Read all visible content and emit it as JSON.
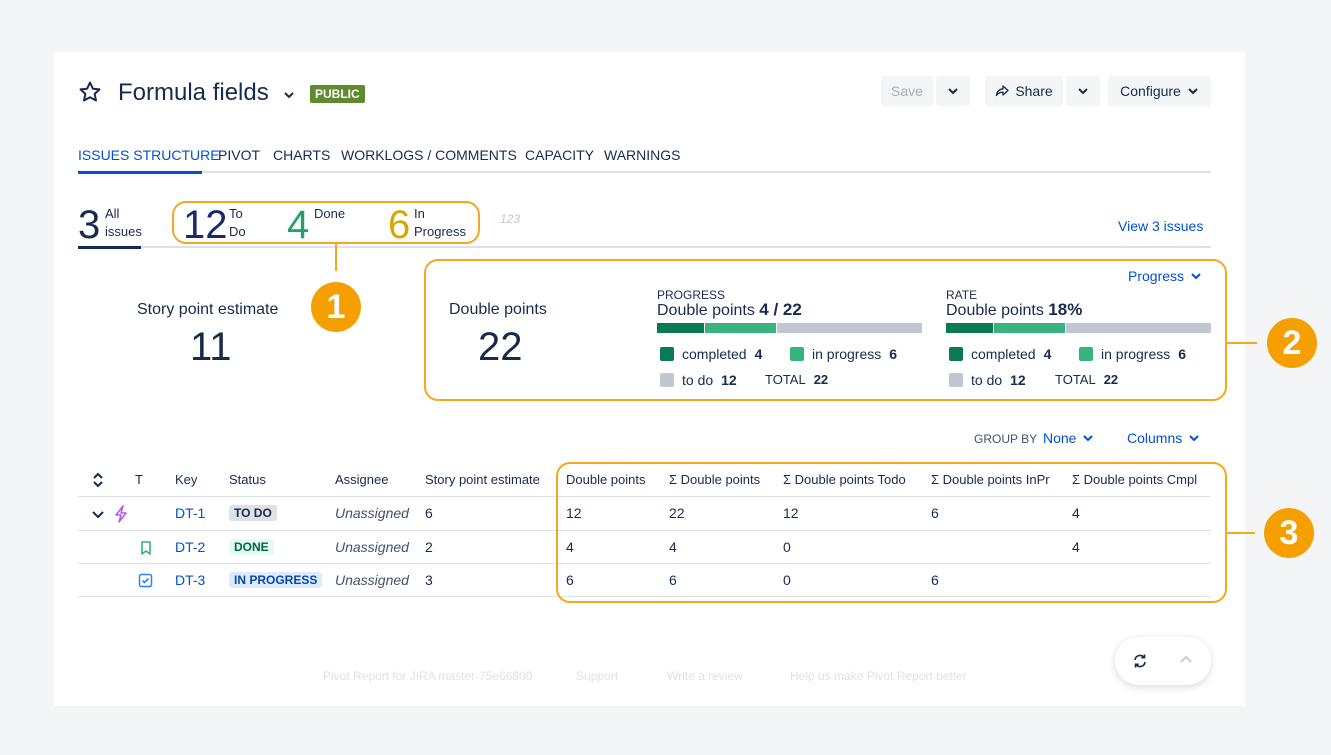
{
  "header": {
    "title": "Formula fields",
    "badge": "PUBLIC",
    "save_label": "Save",
    "share_label": "Share",
    "configure_label": "Configure"
  },
  "tabs": [
    {
      "label": "ISSUES STRUCTURE",
      "active": true
    },
    {
      "label": "PIVOT"
    },
    {
      "label": "CHARTS"
    },
    {
      "label": "WORKLOGS / COMMENTS"
    },
    {
      "label": "CAPACITY"
    },
    {
      "label": "WARNINGS"
    }
  ],
  "summary": {
    "all": {
      "value": "3",
      "label1": "All",
      "label2": "issues"
    },
    "todo": {
      "value": "12",
      "label1": "To",
      "label2": "Do",
      "color": "#172b70"
    },
    "done": {
      "value": "4",
      "label1": "Done",
      "color": "#22a06b"
    },
    "inprogress": {
      "value": "6",
      "label1": "In",
      "label2": "Progress",
      "color": "#d4a800"
    },
    "numbers_icon": "123",
    "view_link": "View 3 issues"
  },
  "stats": {
    "story": {
      "title": "Story point estimate",
      "value": "11"
    },
    "double": {
      "title": "Double points",
      "value": "22"
    },
    "progress_menu": "Progress",
    "progress": {
      "caption": "PROGRESS",
      "title": "Double points",
      "value": "4 / 22",
      "completed_fraction": 0.18,
      "inprogress_fraction": 0.27,
      "completed_label": "completed",
      "completed_value": "4",
      "inprogress_label": "in progress",
      "inprogress_value": "6",
      "todo_label": "to do",
      "todo_value": "12",
      "total_label": "TOTAL",
      "total_value": "22"
    },
    "rate": {
      "caption": "RATE",
      "title": "Double points",
      "value": "18%",
      "completed_fraction": 0.18,
      "inprogress_fraction": 0.27,
      "completed_label": "completed",
      "completed_value": "4",
      "inprogress_label": "in progress",
      "inprogress_value": "6",
      "todo_label": "to do",
      "todo_value": "12",
      "total_label": "TOTAL",
      "total_value": "22"
    },
    "colors": {
      "completed": "#0b7a53",
      "inprogress": "#36b37e",
      "todo": "#c1c7d0"
    }
  },
  "toolbar": {
    "group_by_label": "GROUP BY",
    "group_by_value": "None",
    "columns_label": "Columns"
  },
  "table": {
    "headers": {
      "t": "T",
      "key": "Key",
      "status": "Status",
      "assignee": "Assignee",
      "story": "Story point estimate",
      "dp": "Double points",
      "sdp": "Σ Double points",
      "sdpt": "Σ Double points Todo",
      "sdpi": "Σ Double points InPr",
      "sdpc": "Σ Double points Cmpl"
    },
    "rows": [
      {
        "key": "DT-1",
        "type_icon": "epic-icon",
        "status": "TO DO",
        "assignee": "Unassigned",
        "story": "6",
        "dp": "12",
        "sdp": "22",
        "sdpt": "12",
        "sdpi": "6",
        "sdpc": "4"
      },
      {
        "key": "DT-2",
        "type_icon": "story-icon",
        "status": "DONE",
        "assignee": "Unassigned",
        "story": "2",
        "dp": "4",
        "sdp": "4",
        "sdpt": "0",
        "sdpi": "",
        "sdpc": "4"
      },
      {
        "key": "DT-3",
        "type_icon": "task-icon",
        "status": "IN PROGRESS",
        "assignee": "Unassigned",
        "story": "3",
        "dp": "6",
        "sdp": "6",
        "sdpt": "0",
        "sdpi": "6",
        "sdpc": ""
      }
    ]
  },
  "callouts": [
    "1",
    "2",
    "3"
  ],
  "footer": {
    "version": "Pivot Report for JIRA master-75e66800",
    "support": "Support",
    "review": "Write a review",
    "improve": "Help us make Pivot Report better"
  }
}
